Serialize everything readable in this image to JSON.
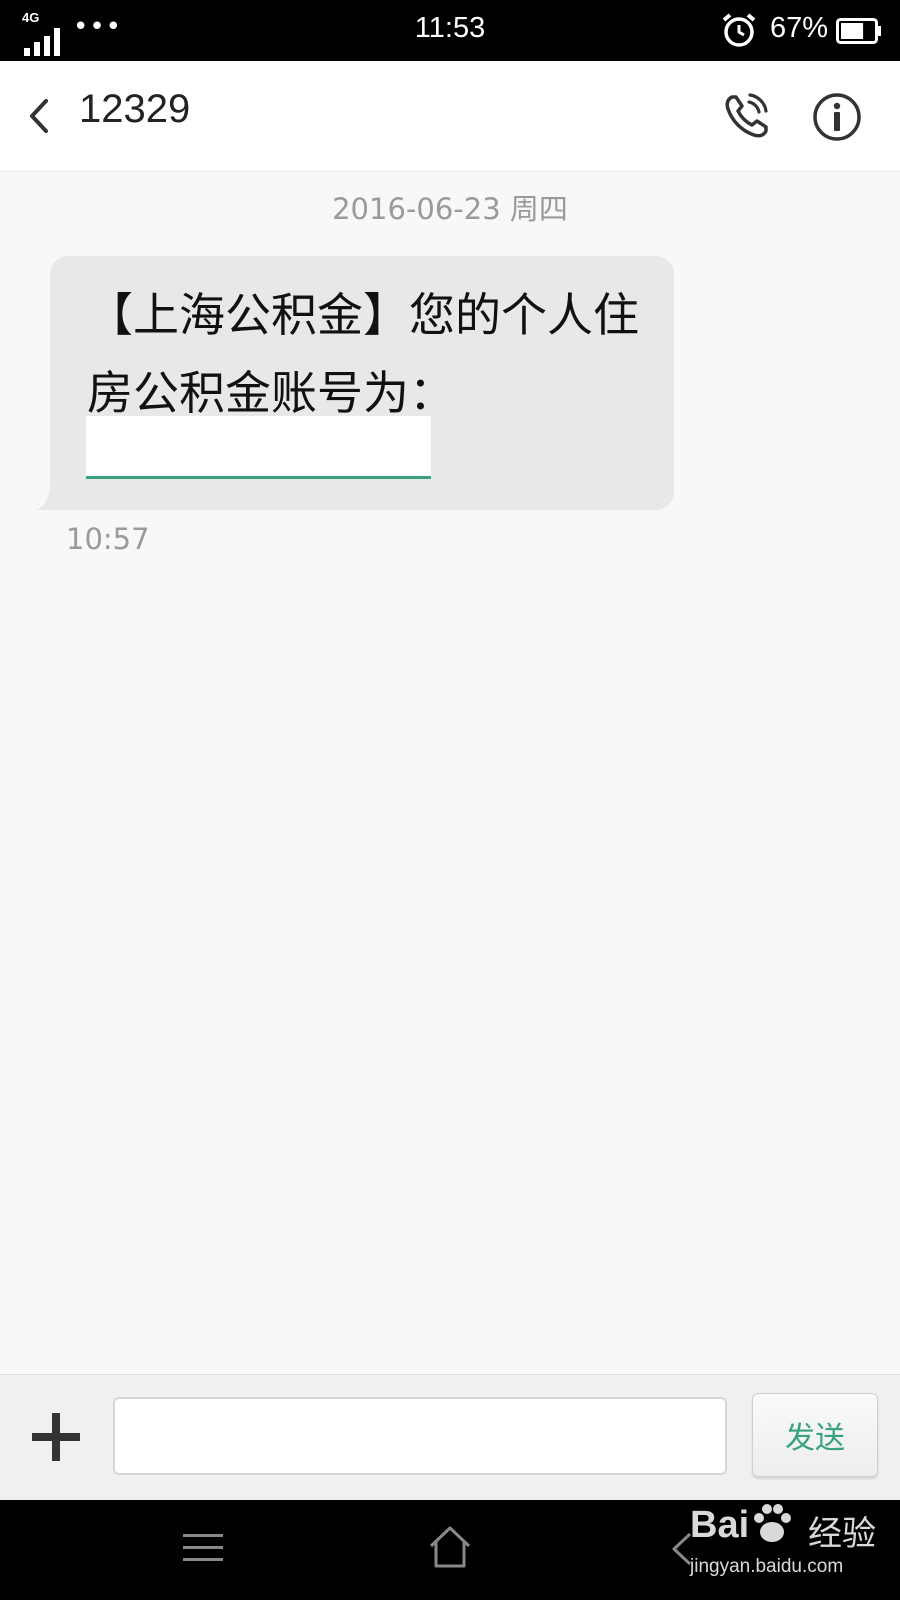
{
  "status_bar": {
    "network": "4G",
    "clock": "11:53",
    "battery_percent": "67%",
    "battery_level": 0.67,
    "icons": [
      "signal-icon",
      "more-dots-icon",
      "alarm-icon",
      "battery-icon"
    ]
  },
  "header": {
    "title": "12329",
    "icons": [
      "back-icon",
      "phone-call-icon",
      "info-icon"
    ]
  },
  "conversation": {
    "date_separator": "2016-06-23 周四",
    "messages": [
      {
        "text": "【上海公积金】您的个人住房公积金账号为：",
        "time": "10:57",
        "direction": "incoming"
      }
    ]
  },
  "composer": {
    "input_value": "",
    "send_label": "发送",
    "icons": [
      "plus-icon"
    ]
  },
  "navbar": {
    "icons": [
      "menu-icon",
      "home-icon",
      "back-nav-icon"
    ]
  },
  "watermark": {
    "logo_text": "Bai",
    "logo_cn": "经验",
    "url": "jingyan.baidu.com"
  },
  "colors": {
    "accent": "#3aa37b",
    "bubble": "#e8e8ea",
    "background": "#f8f8fa"
  }
}
